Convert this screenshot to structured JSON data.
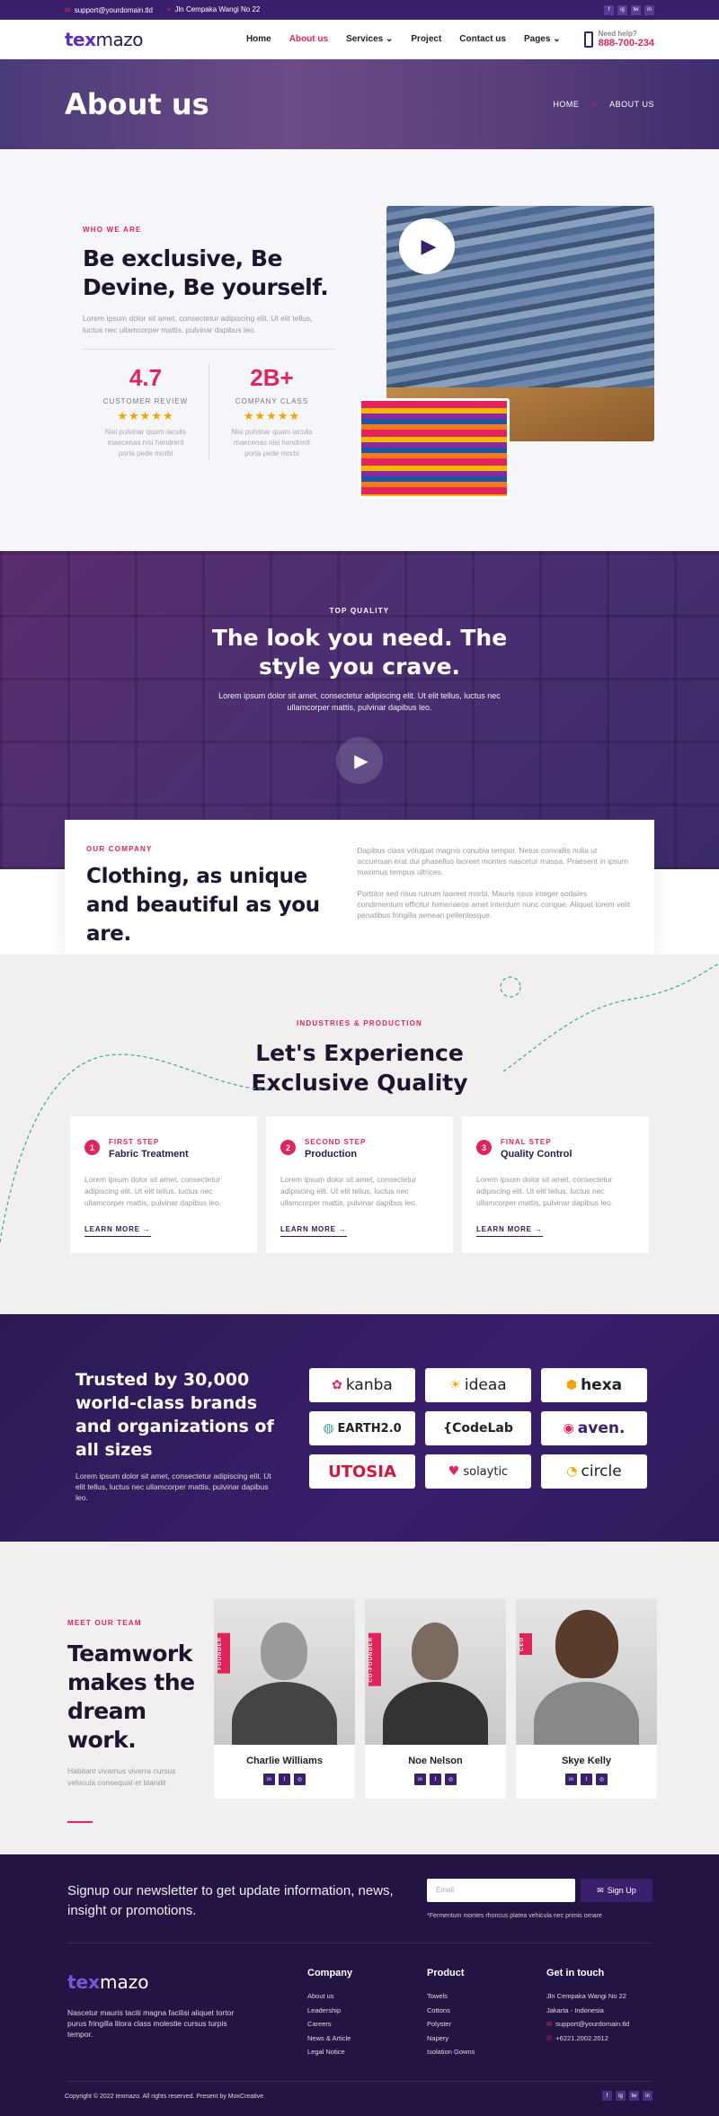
{
  "topbar": {
    "email": "support@yourdomain.tld",
    "address": "Jln Cempaka Wangi No 22",
    "social": [
      "f",
      "ig",
      "tw",
      "in"
    ]
  },
  "nav": {
    "logo_tex": "tex",
    "logo_mazo": "mazo",
    "items": [
      "Home",
      "About us",
      "Services",
      "Project",
      "Contact us",
      "Pages"
    ],
    "active": "About us",
    "help_label": "Need help?",
    "phone": "888-700-234"
  },
  "banner": {
    "title": "About us",
    "crumb_home": "HOME",
    "crumb_sep": ">",
    "crumb_current": "ABOUT US"
  },
  "who": {
    "tag": "WHO WE ARE",
    "title": "Be exclusive, Be Devine, Be yourself.",
    "desc": "Lorem ipsum dolor sit amet, consectetur adipiscing elit. Ut elit tellus, luctus nec ullamcorper mattis, pulvinar dapibus leo.",
    "stats": [
      {
        "value": "4.7",
        "label": "CUSTOMER REVIEW",
        "stars": "★★★★★",
        "text": "Nisi pulvinar quam iaculis maecenas nisi hendrerit porta pede morbi"
      },
      {
        "value": "2B+",
        "label": "COMPANY CLASS",
        "stars": "★★★★★",
        "text": "Nisi pulvinar quam iaculis maecenas nisi hendrerit porta pede morbi"
      }
    ]
  },
  "quality": {
    "tag": "TOP QUALITY",
    "title": "The look you need. The style you crave.",
    "desc": "Lorem ipsum dolor sit amet, consectetur adipiscing elit. Ut elit tellus, luctus nec ullamcorper mattis, pulvinar dapibus leo."
  },
  "company": {
    "tag": "OUR COMPANY",
    "title": "Clothing, as unique and beautiful as you are.",
    "p1": "Dapibus class volutpat magnis conubia tempor. Netus convallis nulla ut accumsan erat dui phasellus laoreet montes nascetur massa. Praesent in ipsum maximus tempus ultrices.",
    "p2": "Porttitor sed risus rutrum laoreet morbi. Mauris risus integer sodales condimentum efficitur himenaeos amet interdum nunc congue. Aliquet lorem velit penatibus fringilla aenean pellentesque."
  },
  "industries": {
    "tag": "INDUSTRIES & PRODUCTION",
    "title": "Let's Experience Exclusive Quality",
    "steps": [
      {
        "n": "1",
        "step": "FIRST STEP",
        "title": "Fabric Treatment",
        "text": "Lorem ipsum dolor sit amet, consectetur adipiscing elit. Ut elit tellus, luctus nec ullamcorper mattis, pulvinar dapibus leo.",
        "more": "LEARN MORE →"
      },
      {
        "n": "2",
        "step": "SECOND STEP",
        "title": "Production",
        "text": "Lorem ipsum dolor sit amet, consectetur adipiscing elit. Ut elit tellus, luctus nec ullamcorper mattis, pulvinar dapibus leo.",
        "more": "LEARN MORE →"
      },
      {
        "n": "3",
        "step": "FINAL STEP",
        "title": "Quality Control",
        "text": "Lorem ipsum dolor sit amet, consectetur adipiscing elit. Ut elit tellus, luctus nec ullamcorper mattis, pulvinar dapibus leo.",
        "more": "LEARN MORE →"
      }
    ]
  },
  "trusted": {
    "title": "Trusted by 30,000 world-class brands and organizations of all sizes",
    "desc": "Lorem ipsum dolor sit amet, consectetur adipiscing elit. Ut elit tellus, luctus nec ullamcorper mattis, pulvinar dapibus leo.",
    "logos": [
      "kanba",
      "ideaa",
      "hexa",
      "EARTH2.0",
      "{CodeLab",
      "aven.",
      "UTOSIA",
      "solaytic",
      "circle"
    ]
  },
  "team": {
    "tag": "MEET OUR TEAM",
    "title": "Teamwork makes the dream work.",
    "desc": "Habitant vivamus viverra cursus vehicula consequat et blandit",
    "members": [
      {
        "name": "Charlie Williams",
        "role": "FOUNDER"
      },
      {
        "name": "Noe Nelson",
        "role": "CO-FOUNDER"
      },
      {
        "name": "Skye Kelly",
        "role": "CEO"
      }
    ]
  },
  "footer": {
    "newsletter": "Signup our newsletter to get update information, news, insight or promotions.",
    "email_placeholder": "Email",
    "signup": "Sign Up",
    "note": "*Fermentum montes rhoncus platea vehicula nec primis ornare",
    "desc": "Nascetur mauris taciti magna facilisi aliquet tortor purus fringilla litora class molestie cursus turpis tempor.",
    "company_title": "Company",
    "company": [
      "About us",
      "Leadership",
      "Careers",
      "News & Article",
      "Legal Notice"
    ],
    "product_title": "Product",
    "product": [
      "Towels",
      "Cottons",
      "Polyster",
      "Napery",
      "Isolation Gowns"
    ],
    "contact_title": "Get in touch",
    "contact": [
      "Jln Cempaka Wangi No 22",
      "Jakarta - Indonesia",
      "support@yourdomain.tld",
      "+6221.2002.2012"
    ],
    "copyright": "Copyright © 2022 texmazo. All rights reserved. Present by MoxCreative"
  },
  "colors": {
    "accent": "#e3245a",
    "brand": "#3a1f6d",
    "dark": "#241444"
  }
}
